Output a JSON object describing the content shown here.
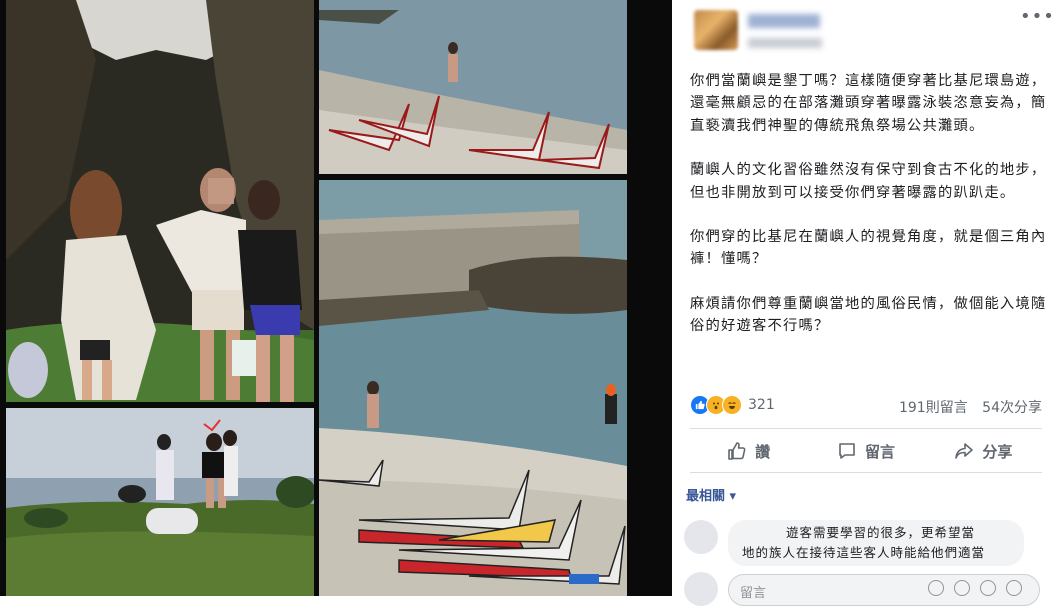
{
  "post": {
    "paragraphs": [
      "你們當蘭嶼是墾丁嗎？這樣隨便穿著比基尼環島遊，還毫無顧忌的在部落灘頭穿著曝露泳裝恣意妄為，簡直褻瀆我們神聖的傳統飛魚祭場公共灘頭。",
      "蘭嶼人的文化習俗雖然沒有保守到食古不化的地步，但也非開放到可以接受你們穿著曝露的趴趴走。",
      "你們穿的比基尼在蘭嶼人的視覺角度，就是個三角內褲！懂嗎？",
      "麻煩請你們尊重蘭嶼當地的風俗民情，做個能入境隨俗的好遊客不行嗎？"
    ],
    "more_icon": "•••"
  },
  "reactions": {
    "count": "321",
    "comments": "191則留言",
    "shares": "54次分享"
  },
  "actions": {
    "like": "讚",
    "comment": "留言",
    "share": "分享"
  },
  "comments": {
    "sort_label": "最相關 ▾",
    "first_line1": "遊客需要學習的很多，更希望當",
    "first_line2": "地的族人在接待這些客人時能給他們適當",
    "reply_placeholder": "留言"
  },
  "colors": {
    "link": "#385898",
    "muted": "#606770",
    "like_blue": "#1877f2"
  }
}
